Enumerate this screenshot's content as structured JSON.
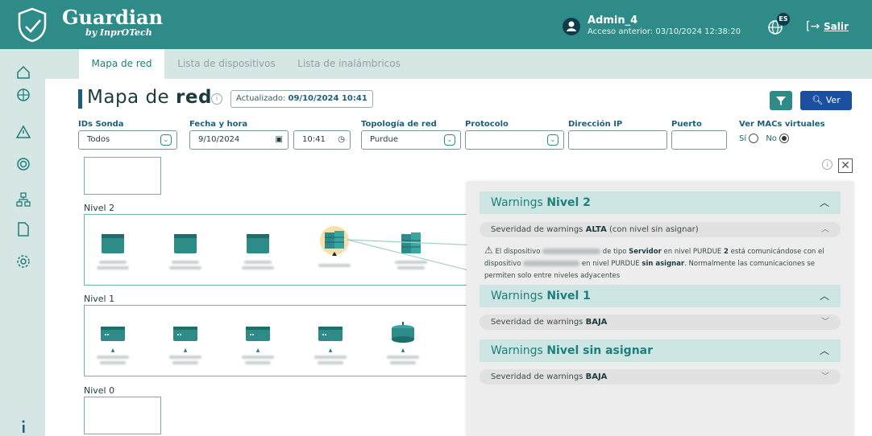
{
  "header": {
    "brand": "Guardian",
    "brand_sub": "by InprOTech",
    "user_name": "Admin_4",
    "last_access": "Acceso anterior: 03/10/2024 12:38:20",
    "lang": "ES",
    "logout": "Salir"
  },
  "tabs": [
    {
      "label": "Mapa de red",
      "active": true
    },
    {
      "label": "Lista de dispositivos",
      "active": false
    },
    {
      "label": "Lista de inalámbricos",
      "active": false
    }
  ],
  "title": {
    "prefix": "Mapa de ",
    "bold": "red"
  },
  "updated": {
    "label": "Actualizado: ",
    "value": "09/10/2024 10:41"
  },
  "buttons": {
    "ver": "Ver"
  },
  "filters": {
    "ids_sonda": {
      "label": "IDs Sonda",
      "value": "Todos"
    },
    "fecha_hora": {
      "label": "Fecha y hora",
      "date": "9/10/2024",
      "time": "10:41"
    },
    "topologia": {
      "label": "Topología de red",
      "value": "Purdue"
    },
    "protocolo": {
      "label": "Protocolo",
      "value": ""
    },
    "ip": {
      "label": "Dirección IP",
      "value": ""
    },
    "puerto": {
      "label": "Puerto",
      "value": ""
    },
    "macs": {
      "label": "Ver MACs virtuales",
      "yes": "Sí",
      "no": "No",
      "selected": "No"
    }
  },
  "levels": {
    "nivel2": "Nivel 2",
    "nivel1": "Nivel 1",
    "nivel0": "Nivel 0"
  },
  "warnings": {
    "n2": {
      "prefix": "Warnings ",
      "bold": "Nivel 2"
    },
    "n2_sev": {
      "prefix": "Severidad de warnings ",
      "bold": "ALTA",
      "suffix": " (con nivel sin asignar)"
    },
    "msg": {
      "p1": "El dispositivo ",
      "p2": " de tipo ",
      "b1": "Servidor",
      "p3": " en nivel PURDUE ",
      "b2": "2",
      "p4": " está comunicándose con el dispositivo ",
      "p5": " en nivel PURDUE ",
      "b3": "sin asignar",
      "p6": ". Normalmente las comunicaciones se permiten solo entre niveles adyacentes"
    },
    "n1": {
      "prefix": "Warnings ",
      "bold": "Nivel 1"
    },
    "n1_sev": {
      "prefix": "Severidad de warnings ",
      "bold": "BAJA"
    },
    "nsa": {
      "prefix": "Warnings ",
      "bold": "Nivel sin asignar"
    },
    "nsa_sev": {
      "prefix": "Severidad de warnings ",
      "bold": "BAJA"
    }
  },
  "colors": {
    "primary": "#2e8b87",
    "accent_blue": "#1b4fa0",
    "server_highlight": "#f6b73c"
  }
}
